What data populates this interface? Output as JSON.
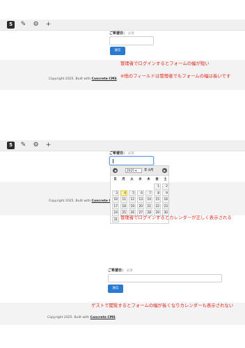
{
  "toolbar": {
    "logo": "5"
  },
  "field": {
    "label": "ご希望日：",
    "required": "必須"
  },
  "submit": "送信",
  "footer": {
    "prefix": "Copyright 2025. Built with ",
    "brand": "Concrete CMS",
    "suffix": "."
  },
  "notes": {
    "note1": "管理者でログインするとフォームの幅が短い",
    "note2": "※他のフィールドは管理者でもフォームの幅は長いです",
    "note3": "管理者でログインするとカレンダーが正しく表示される",
    "note4": "ゲストで閲覧するとフォームの幅が長くなりカレンダーも表示されない"
  },
  "calendar": {
    "prev": "◀",
    "next": "▶",
    "year": "2025",
    "year_suffix": "年",
    "month": "8月",
    "weekdays": [
      "日",
      "月",
      "火",
      "水",
      "木",
      "金",
      "土"
    ],
    "days": [
      [
        "",
        "",
        "",
        "",
        "",
        "1",
        "2"
      ],
      [
        "3",
        "4",
        "5",
        "6",
        "7",
        "8",
        "9"
      ],
      [
        "10",
        "11",
        "12",
        "13",
        "14",
        "15",
        "16"
      ],
      [
        "17",
        "18",
        "19",
        "20",
        "21",
        "22",
        "23"
      ],
      [
        "24",
        "25",
        "26",
        "27",
        "28",
        "29",
        "30"
      ],
      [
        "31",
        "",
        "",
        "",
        "",
        "",
        ""
      ]
    ],
    "today": "4"
  }
}
